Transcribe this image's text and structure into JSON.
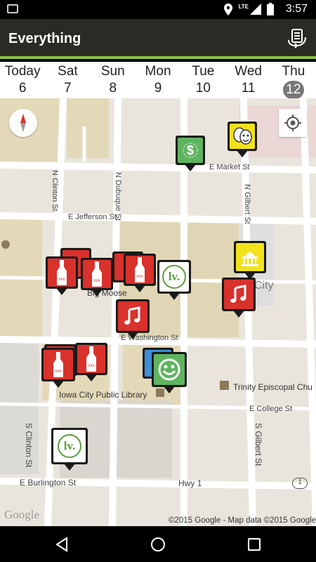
{
  "status_bar": {
    "time": "3:57",
    "network": "LTE",
    "icons": [
      "gallery-icon",
      "location-icon",
      "signal-icon",
      "battery-icon"
    ]
  },
  "action_bar": {
    "title": "Everything",
    "menu_icon": "list-swap-icon",
    "accent_color": "#8dc63f"
  },
  "days": [
    {
      "name": "Today",
      "num": "6",
      "selected": false
    },
    {
      "name": "Sat",
      "num": "7",
      "selected": false
    },
    {
      "name": "Sun",
      "num": "8",
      "selected": false
    },
    {
      "name": "Mon",
      "num": "9",
      "selected": false
    },
    {
      "name": "Tue",
      "num": "10",
      "selected": false
    },
    {
      "name": "Wed",
      "num": "11",
      "selected": false
    },
    {
      "name": "Thu",
      "num": "12",
      "selected": true
    }
  ],
  "map": {
    "streets": {
      "e_market": "E Market St",
      "n_clinton": "N Clinton St",
      "n_dubuque": "N Dubuque St",
      "n_gilbert": "N Gilbert St",
      "e_jefferson": "E Jefferson St",
      "e_washington": "E Washington St",
      "e_college": "E College St",
      "s_clinton": "S Clinton St",
      "s_gilbert": "S Gilbert St",
      "e_burlington": "E Burlington St",
      "hwy1": "Hwy 1",
      "hwy1_shield": "1"
    },
    "places": {
      "library": "Iowa City Public Library",
      "church": "Trinity Episcopal Chu",
      "moose": "Big Moose",
      "city": "City"
    },
    "attribution": "©2015 Google - Map data ©2015 Google",
    "logo": "Google",
    "markers": {
      "money": {
        "category": "money",
        "icon": "dollar-icon",
        "color": "#5fb45f"
      },
      "theater": {
        "category": "theater",
        "icon": "theater-masks-icon",
        "color": "#f2e21c"
      },
      "museum": {
        "category": "museum",
        "icon": "capitol-building-icon",
        "color": "#f2e21c"
      },
      "music_east": {
        "category": "music",
        "icon": "music-note-icon",
        "color": "#d9312b"
      },
      "music_center": {
        "category": "music",
        "icon": "music-note-icon",
        "color": "#d9312b"
      },
      "lv_center": {
        "category": "venue",
        "icon": "lv-logo-icon",
        "text": "lv."
      },
      "lv_south": {
        "category": "venue",
        "icon": "lv-logo-icon",
        "text": "lv."
      },
      "smiley": {
        "category": "comedy",
        "icon": "smiley-icon",
        "color": "#5fb45f"
      },
      "bars": {
        "category": "bars",
        "icon": "beer-bottle-icon",
        "color": "#d9312b"
      }
    }
  }
}
